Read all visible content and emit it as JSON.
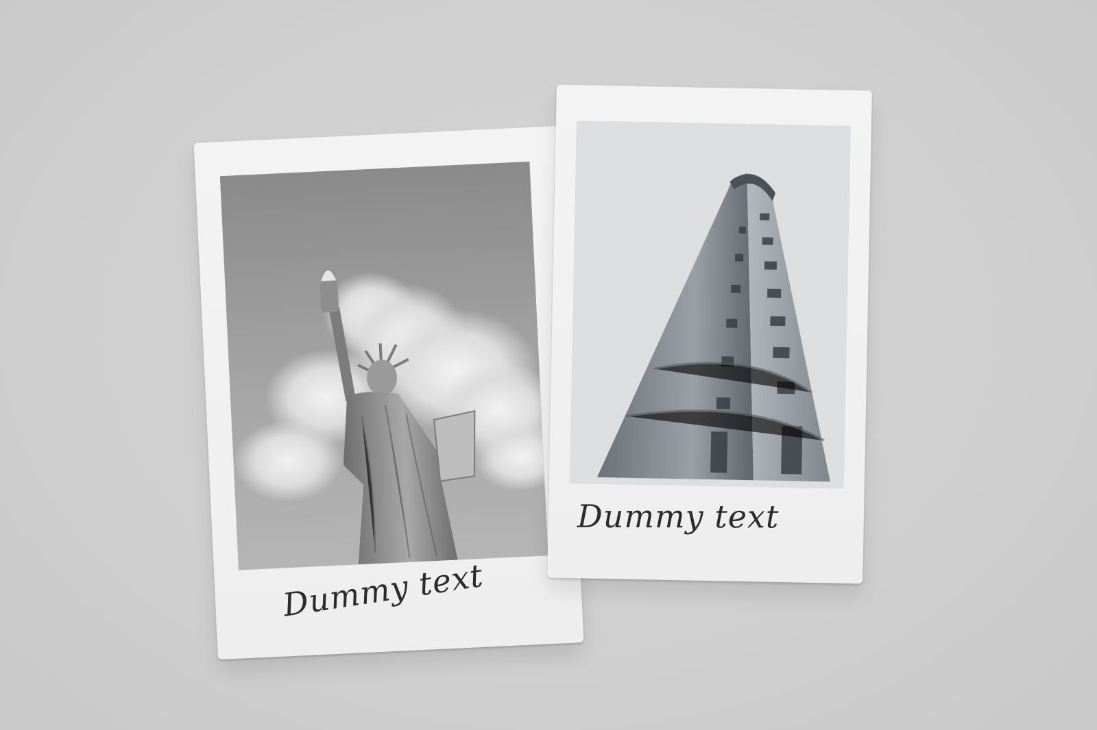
{
  "photos": [
    {
      "subject": "statue-of-liberty",
      "caption": "Dummy text"
    },
    {
      "subject": "flatiron-building",
      "caption": "Dummy text"
    }
  ],
  "colors": {
    "background": "#d1d1d1",
    "paper": "#f1f1f1",
    "ink": "#2b2b2b"
  }
}
